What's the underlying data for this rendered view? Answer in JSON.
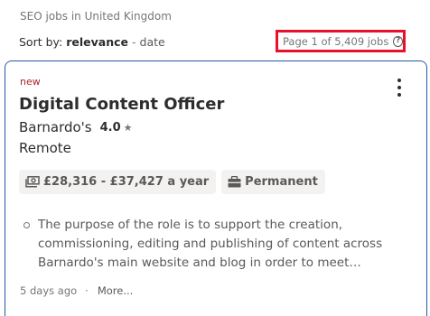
{
  "breadcrumb": "SEO jobs in United Kingdom",
  "sort": {
    "prefix": "Sort by:",
    "active": "relevance",
    "separator": "-",
    "other": "date"
  },
  "page_count": "Page 1 of 5,409 jobs",
  "page_count_help_glyph": "?",
  "highlight_color": "#e8102a",
  "accent_color": "#2557a7",
  "job": {
    "new_label": "new",
    "title": "Digital Content Officer",
    "company": "Barnardo's",
    "rating": "4.0",
    "rating_glyph": "★",
    "location": "Remote",
    "salary": "£28,316 - £37,427 a year",
    "job_type": "Permanent",
    "snippet": "The purpose of the role is to support the creation, commissioning, editing and publishing of content across Barnardo's main website and blog in order to meet…",
    "posted": "5 days ago",
    "footer_dot": "·",
    "more_label": "More..."
  }
}
